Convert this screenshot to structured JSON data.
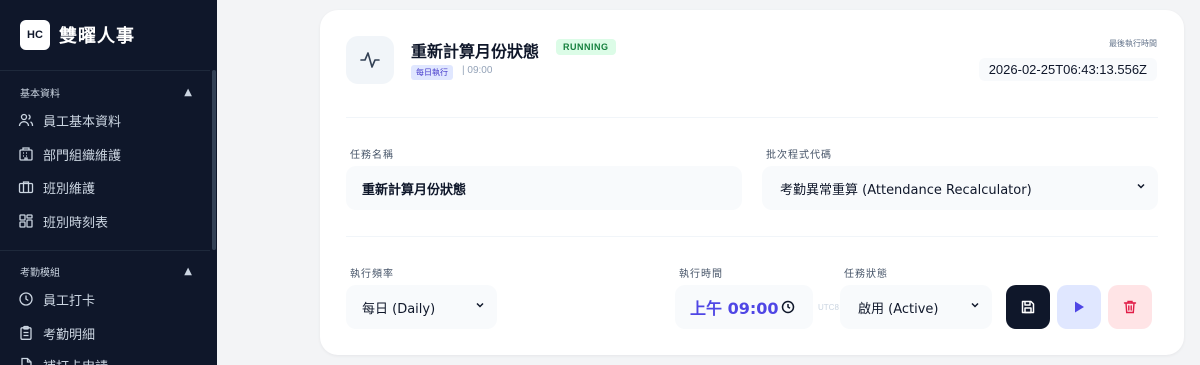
{
  "brand": {
    "logo_text": "HC",
    "name": "雙曜人事"
  },
  "sidebar": {
    "sections": [
      {
        "label": "基本資料",
        "caret": "▲"
      },
      {
        "label": "考勤模組",
        "caret": "▲"
      }
    ],
    "items": [
      {
        "label": "員工基本資料",
        "icon": "users-icon"
      },
      {
        "label": "部門組織維護",
        "icon": "building-icon"
      },
      {
        "label": "班別維護",
        "icon": "briefcase-icon"
      },
      {
        "label": "班別時刻表",
        "icon": "grid-icon"
      },
      {
        "label": "員工打卡",
        "icon": "clock-icon"
      },
      {
        "label": "考勤明細",
        "icon": "clipboard-icon"
      },
      {
        "label": "補打卡申請",
        "icon": "file-icon"
      }
    ]
  },
  "job": {
    "title": "重新計算月份狀態",
    "status": "RUNNING",
    "frequency_badge": "每日執行",
    "time_meta": "| 09:00",
    "last_run_label": "最後執行時間",
    "last_run_value": "2026-02-25T06:43:13.556Z"
  },
  "form": {
    "task_name_label": "任務名稱",
    "task_name_value": "重新計算月份狀態",
    "program_label": "批次程式代碼",
    "program_value": "考勤異常重算 (Attendance Recalculator)",
    "frequency_label": "執行頻率",
    "frequency_value": "每日 (Daily)",
    "time_label": "執行時間",
    "time_value": "上午 09:00",
    "timezone": "UTC8",
    "status_label": "任務狀態",
    "status_value": "啟用 (Active)"
  },
  "colors": {
    "sidebar_bg": "#0f172a",
    "accent": "#4f46e5",
    "running": "#15803d",
    "danger": "#e11d48",
    "save_bg": "#0f172a"
  }
}
